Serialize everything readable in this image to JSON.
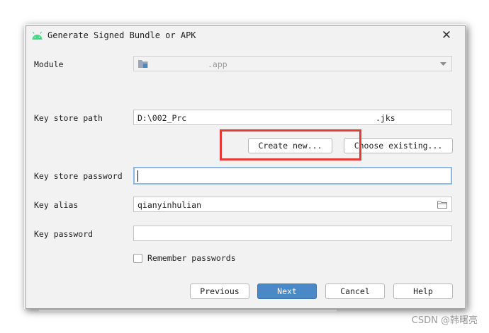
{
  "dialog": {
    "title": "Generate Signed Bundle or APK",
    "close_glyph": "✕"
  },
  "form": {
    "module_label": "Module",
    "module_value": ".app",
    "keystore_path_label": "Key store path",
    "keystore_path_prefix": "D:\\002_Prc",
    "keystore_path_suffix": ".jks",
    "create_new_label": "Create new...",
    "choose_existing_label": "Choose existing...",
    "keystore_password_label": "Key store password",
    "key_alias_label": "Key alias",
    "key_alias_value": "qianyinhulian",
    "key_password_label": "Key password",
    "remember_label": "Remember passwords"
  },
  "buttons": {
    "previous": "Previous",
    "next": "Next",
    "cancel": "Cancel",
    "help": "Help"
  },
  "watermark": "CSDN @韩曙亮",
  "colors": {
    "highlight": "#e53935",
    "primary": "#4a88c7",
    "android_green": "#3ddc84"
  },
  "icons": [
    "android-logo-icon",
    "close-icon",
    "module-folder-icon",
    "chevron-down-icon",
    "folder-icon"
  ]
}
